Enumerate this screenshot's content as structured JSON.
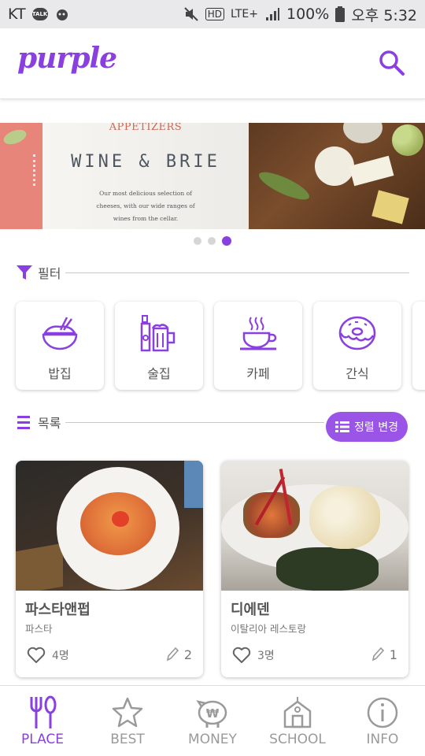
{
  "status_bar": {
    "carrier": "KT",
    "network": "LTE+",
    "battery": "100%",
    "time": "오후 5:32",
    "icons": [
      "talk-icon",
      "bug-icon",
      "mute-icon",
      "hd-icon",
      "signal-icon",
      "battery-icon"
    ]
  },
  "header": {
    "logo": "Purple",
    "search_icon": "search-icon"
  },
  "banner": {
    "kicker": "APPETIZERS",
    "title": "WINE & BRIE",
    "desc_line1": "Our most delicious selection of",
    "desc_line2": "cheeses, with our wide ranges of",
    "desc_line3": "wines from the cellar.",
    "page_count": 3,
    "active_page": 3
  },
  "filter": {
    "label": "필터",
    "icon": "funnel-icon",
    "categories": [
      {
        "label": "밥집",
        "icon": "rice-bowl-icon"
      },
      {
        "label": "술집",
        "icon": "beer-icon"
      },
      {
        "label": "카페",
        "icon": "coffee-icon"
      },
      {
        "label": "간식",
        "icon": "donut-icon"
      }
    ]
  },
  "list": {
    "label": "목록",
    "icon": "list-icon",
    "sort_button": "정렬 변경",
    "sort_icon": "list-view-icon"
  },
  "places": [
    {
      "name": "파스타앤펍",
      "category": "파스타",
      "likes": "4명",
      "reviews": "2"
    },
    {
      "name": "디에덴",
      "category": "이탈리아 레스토랑",
      "likes": "3명",
      "reviews": "1"
    }
  ],
  "colors": {
    "accent": "#8a3fe0",
    "button": "#9a55e6",
    "inactive": "#9a9a9a"
  },
  "bottom_nav": [
    {
      "label": "PLACE",
      "icon": "fork-knife-icon",
      "active": true
    },
    {
      "label": "BEST",
      "icon": "star-icon",
      "active": false
    },
    {
      "label": "MONEY",
      "icon": "piggy-bank-icon",
      "active": false
    },
    {
      "label": "SCHOOL",
      "icon": "school-icon",
      "active": false
    },
    {
      "label": "INFO",
      "icon": "info-icon",
      "active": false
    }
  ]
}
